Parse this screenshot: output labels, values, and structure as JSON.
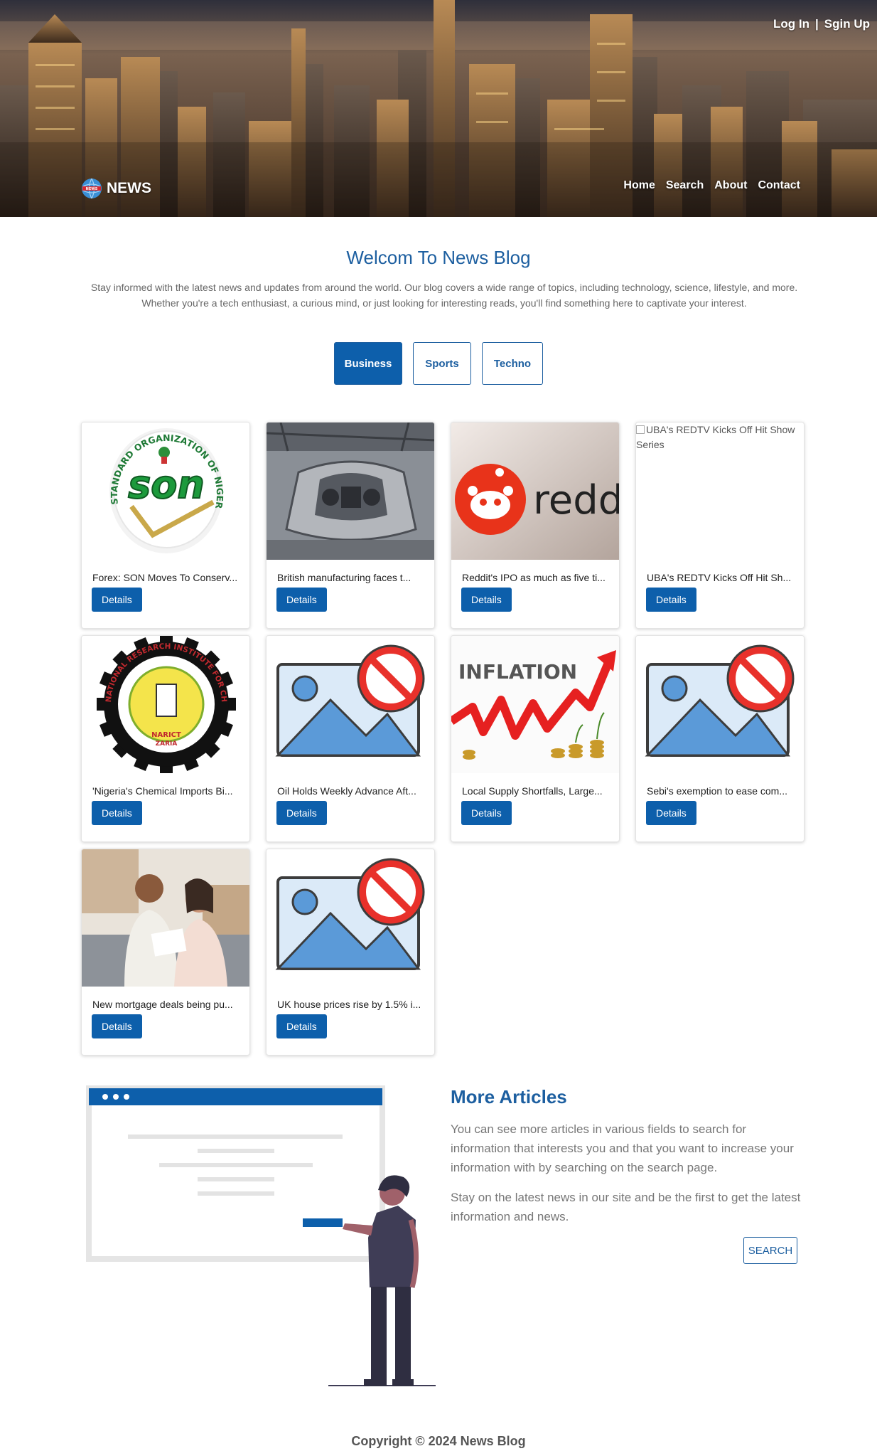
{
  "header": {
    "login_label": "Log In",
    "separator": "|",
    "signup_label": "Sgin Up",
    "brand_name": "NEWS",
    "brand_logo_text": "NEWS",
    "nav": [
      "Home",
      "Search",
      "About",
      "Contact"
    ]
  },
  "intro": {
    "title": "Welcom To News Blog",
    "text": "Stay informed with the latest news and updates from around the world. Our blog covers a wide range of topics, including technology, science, lifestyle, and more. Whether you're a tech enthusiast, a curious mind, or just looking for interesting reads, you'll find something here to captivate your interest."
  },
  "tabs": [
    {
      "label": "Business",
      "active": true
    },
    {
      "label": "Sports",
      "active": false
    },
    {
      "label": "Techno",
      "active": false
    }
  ],
  "cards": [
    {
      "title": "Forex: SON Moves To Conserv...",
      "button": "Details",
      "image": "son-logo",
      "image_texts": [
        "STANDARD ORGANIZATION OF NIGERIA",
        "son"
      ]
    },
    {
      "title": "British manufacturing faces t...",
      "button": "Details",
      "image": "car-factory-photo"
    },
    {
      "title": "Reddit's IPO as much as five ti...",
      "button": "Details",
      "image": "reddit-photo",
      "image_texts": [
        "reddit"
      ]
    },
    {
      "title": "UBA's REDTV Kicks Off Hit Sh...",
      "button": "Details",
      "image": "broken-image",
      "alt": "UBA's REDTV Kicks Off Hit Show Series"
    },
    {
      "title": "'Nigeria's Chemical Imports Bi...",
      "button": "Details",
      "image": "narict-logo",
      "image_texts": [
        "NATIONAL RESEARCH INSTITUTE FOR CHEMICAL TECHNOLOGY",
        "NARICT",
        "ZARIA"
      ]
    },
    {
      "title": "Oil Holds Weekly Advance Aft...",
      "button": "Details",
      "image": "no-image-icon"
    },
    {
      "title": "Local Supply Shortfalls, Large...",
      "button": "Details",
      "image": "inflation-chart",
      "image_texts": [
        "INFLATION"
      ]
    },
    {
      "title": "Sebi's exemption to ease com...",
      "button": "Details",
      "image": "no-image-icon"
    },
    {
      "title": "New mortgage deals being pu...",
      "button": "Details",
      "image": "couple-photo"
    },
    {
      "title": "UK house prices rise by 1.5% i...",
      "button": "Details",
      "image": "no-image-icon"
    }
  ],
  "more": {
    "title": "More Articles",
    "p1": "You can see more articles in various fields to search for information that interests you and that you want to increase your information with by searching on the search page.",
    "p2": "Stay on the latest news in our site and be the first to get the latest information and news.",
    "button": "SEARCH"
  },
  "footer": {
    "text": "Copyright © 2024 News Blog"
  },
  "colors": {
    "primary": "#0d5fab",
    "heading": "#1d5fa0"
  }
}
